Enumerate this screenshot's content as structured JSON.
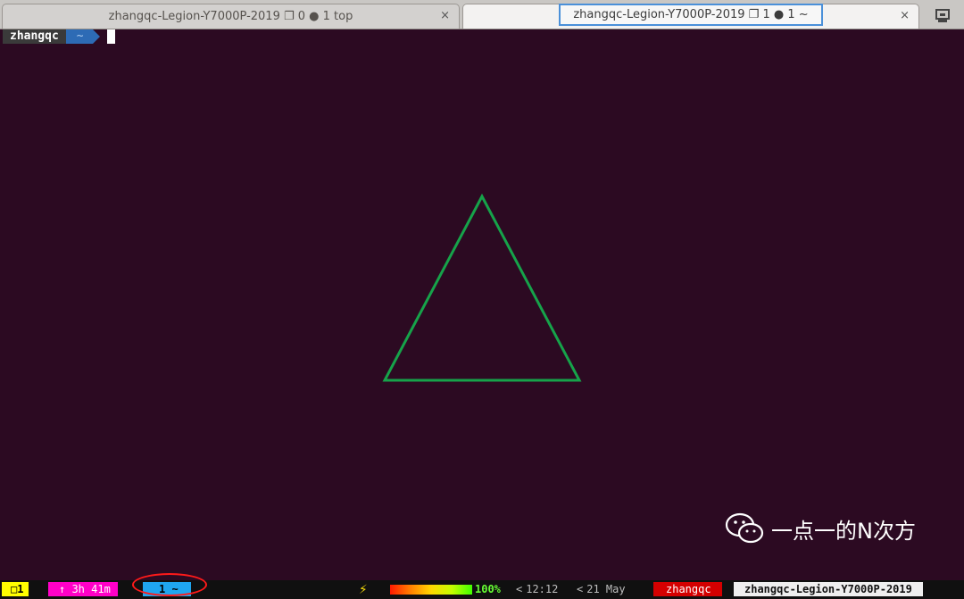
{
  "tabs": [
    {
      "title": "zhangqc-Legion-Y7000P-2019 ❐ 0 ●  1 top",
      "close": "×"
    },
    {
      "title": "zhangqc-Legion-Y7000P-2019 ❐ 1 ●  1 ~",
      "close": "×"
    }
  ],
  "prompt": {
    "user": "zhangqc",
    "dir": "~"
  },
  "watermark": {
    "text": "一点一的N次方"
  },
  "statusbar": {
    "window_indicator": "□1",
    "uptime": "↑ 3h 41m",
    "current_window": "1 ~",
    "bolt": "⚡",
    "battery_percent": "100%",
    "battery_level": 1.0,
    "time": "12:12",
    "date": "21 May",
    "user": "zhangqc",
    "hostname": "zhangqc-Legion-Y7000P-2019"
  },
  "colors": {
    "terminal_bg": "#2c0a22",
    "triangle_stroke": "#16a34a"
  }
}
